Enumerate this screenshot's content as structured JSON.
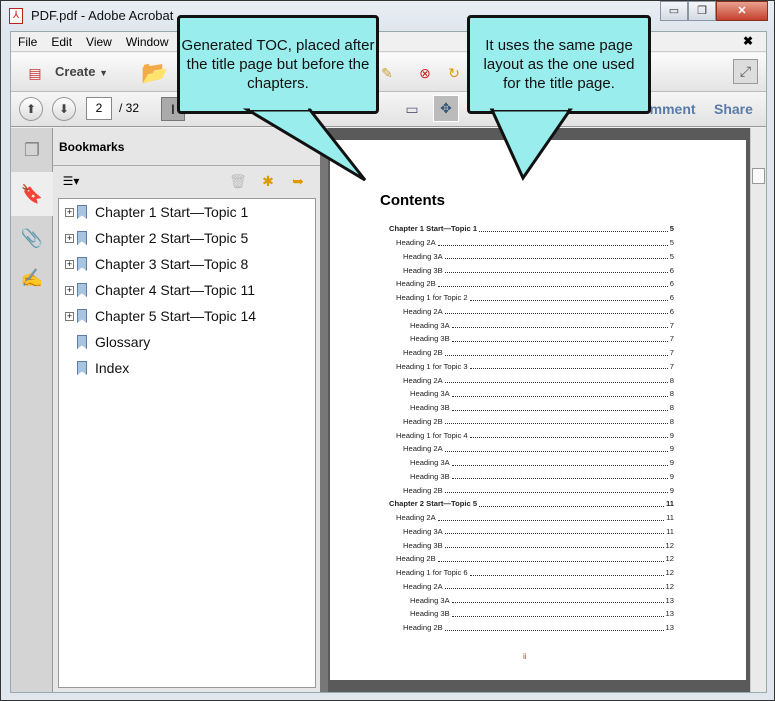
{
  "window": {
    "title": "PDF.pdf - Adobe Acrobat",
    "minimize": "▭",
    "restore": "❐",
    "close": "✕"
  },
  "menu": [
    "File",
    "Edit",
    "View",
    "Window"
  ],
  "menu_close": "✖",
  "toolbar": {
    "create_label": "Create",
    "page_current": "2",
    "page_total": "/ 32",
    "comment_tab": "Comment",
    "share_tab": "Share"
  },
  "bookmarks": {
    "title": "Bookmarks",
    "items": [
      {
        "label": "Chapter 1 Start—Topic 1",
        "expandable": true
      },
      {
        "label": "Chapter 2 Start—Topic 5",
        "expandable": true
      },
      {
        "label": "Chapter 3 Start—Topic 8",
        "expandable": true
      },
      {
        "label": "Chapter 4 Start—Topic 11",
        "expandable": true
      },
      {
        "label": "Chapter 5 Start—Topic 14",
        "expandable": true
      },
      {
        "label": "Glossary",
        "expandable": false
      },
      {
        "label": "Index",
        "expandable": false
      }
    ]
  },
  "document": {
    "heading": "Contents",
    "page_label": "ii",
    "toc": [
      {
        "text": "Chapter 1 Start—Topic 1",
        "page": "5",
        "level": 0
      },
      {
        "text": "Heading 2A",
        "page": "5",
        "level": 1
      },
      {
        "text": "Heading 3A",
        "page": "5",
        "level": 2
      },
      {
        "text": "Heading 3B",
        "page": "6",
        "level": 2
      },
      {
        "text": "Heading 2B",
        "page": "6",
        "level": 1
      },
      {
        "text": "Heading 1 for Topic 2",
        "page": "6",
        "level": 1
      },
      {
        "text": "Heading 2A",
        "page": "6",
        "level": 2
      },
      {
        "text": "Heading 3A",
        "page": "7",
        "level": 3
      },
      {
        "text": "Heading 3B",
        "page": "7",
        "level": 3
      },
      {
        "text": "Heading 2B",
        "page": "7",
        "level": 2
      },
      {
        "text": "Heading 1 for Topic 3",
        "page": "7",
        "level": 1
      },
      {
        "text": "Heading 2A",
        "page": "8",
        "level": 2
      },
      {
        "text": "Heading 3A",
        "page": "8",
        "level": 3
      },
      {
        "text": "Heading 3B",
        "page": "8",
        "level": 3
      },
      {
        "text": "Heading 2B",
        "page": "8",
        "level": 2
      },
      {
        "text": "Heading 1 for Topic 4",
        "page": "9",
        "level": 1
      },
      {
        "text": "Heading 2A",
        "page": "9",
        "level": 2
      },
      {
        "text": "Heading 3A",
        "page": "9",
        "level": 3
      },
      {
        "text": "Heading 3B",
        "page": "9",
        "level": 3
      },
      {
        "text": "Heading 2B",
        "page": "9",
        "level": 2
      },
      {
        "text": "Chapter 2 Start—Topic 5",
        "page": "11",
        "level": 0
      },
      {
        "text": "Heading 2A",
        "page": "11",
        "level": 1
      },
      {
        "text": "Heading 3A",
        "page": "11",
        "level": 2
      },
      {
        "text": "Heading 3B",
        "page": "12",
        "level": 2
      },
      {
        "text": "Heading 2B",
        "page": "12",
        "level": 1
      },
      {
        "text": "Heading 1 for Topic 6",
        "page": "12",
        "level": 1
      },
      {
        "text": "Heading 2A",
        "page": "12",
        "level": 2
      },
      {
        "text": "Heading 3A",
        "page": "13",
        "level": 3
      },
      {
        "text": "Heading 3B",
        "page": "13",
        "level": 3
      },
      {
        "text": "Heading 2B",
        "page": "13",
        "level": 2
      }
    ]
  },
  "callouts": {
    "toc": "Generated TOC, placed after the title page but before the chapters.",
    "layout": "It uses the same page layout as the one used for the title page."
  },
  "colors": {
    "callout": "#9aeded",
    "tab_text": "#5a7ba8"
  }
}
